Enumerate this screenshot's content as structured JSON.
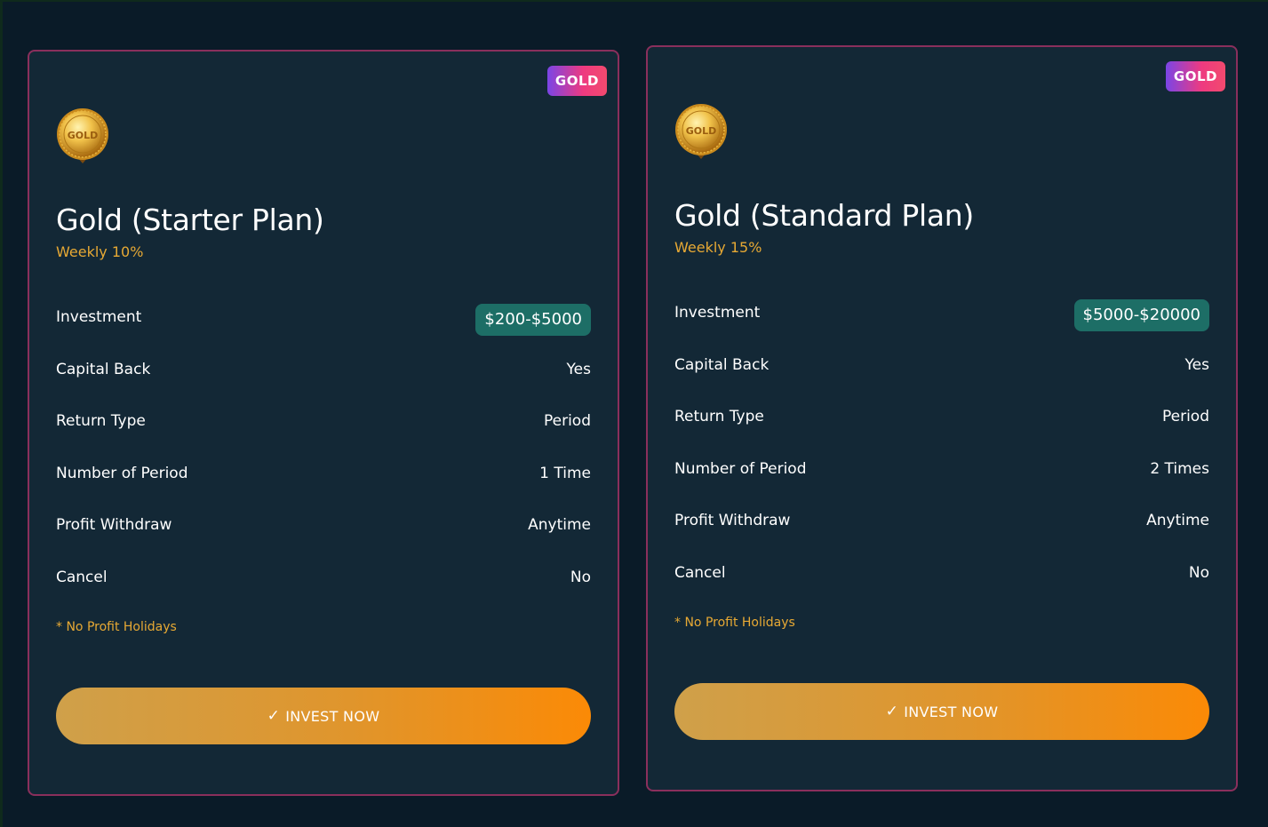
{
  "colors": {
    "background": "#0a1b28",
    "card_background": "#132836",
    "card_border": "#8a2f5c",
    "accent_gold": "#e7a934",
    "pill_teal": "#1d6e66",
    "button_gradient_start": "#cfa04a",
    "button_gradient_end": "#fb8a06"
  },
  "plans": [
    {
      "badge": "GOLD",
      "medal_icon": "gold-medal-icon",
      "medal_text": "GOLD",
      "title": "Gold (Starter Plan)",
      "rate": "Weekly 10%",
      "rows": [
        {
          "label": "Investment",
          "value": "$200-$5000"
        },
        {
          "label": "Capital Back",
          "value": "Yes"
        },
        {
          "label": "Return Type",
          "value": "Period"
        },
        {
          "label": "Number of Period",
          "value": "1 Time"
        },
        {
          "label": "Profit Withdraw",
          "value": "Anytime"
        },
        {
          "label": "Cancel",
          "value": "No"
        }
      ],
      "note": "* No Profit Holidays",
      "button_icon": "✓",
      "button_label": "INVEST NOW"
    },
    {
      "badge": "GOLD",
      "medal_icon": "gold-medal-icon",
      "medal_text": "GOLD",
      "title": "Gold (Standard Plan)",
      "rate": "Weekly 15%",
      "rows": [
        {
          "label": "Investment",
          "value": "$5000-$20000"
        },
        {
          "label": "Capital Back",
          "value": "Yes"
        },
        {
          "label": "Return Type",
          "value": "Period"
        },
        {
          "label": "Number of Period",
          "value": "2 Times"
        },
        {
          "label": "Profit Withdraw",
          "value": "Anytime"
        },
        {
          "label": "Cancel",
          "value": "No"
        }
      ],
      "note": "* No Profit Holidays",
      "button_icon": "✓",
      "button_label": "INVEST NOW"
    }
  ]
}
